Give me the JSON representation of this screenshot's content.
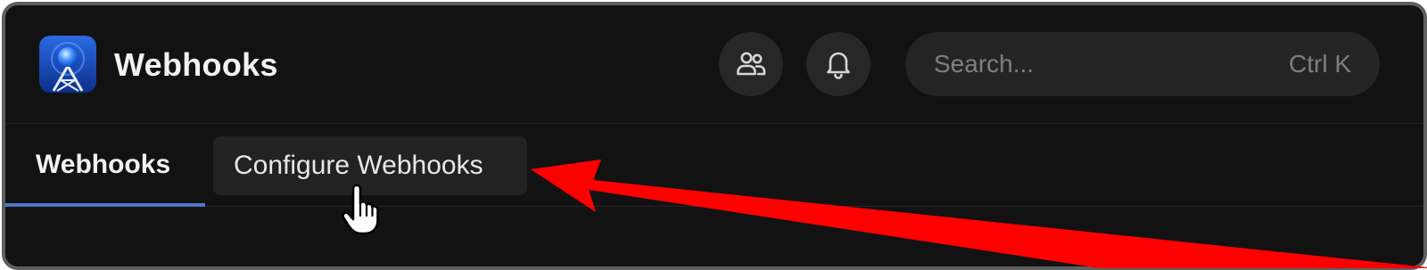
{
  "app": {
    "title": "Webhooks",
    "logo_icon": "radio-tower-icon"
  },
  "header": {
    "actions": [
      {
        "name": "people-button",
        "icon": "people-icon"
      },
      {
        "name": "notifications-button",
        "icon": "bell-icon"
      }
    ]
  },
  "search": {
    "placeholder": "Search...",
    "value": "",
    "shortcut": "Ctrl K"
  },
  "tabs": [
    {
      "label": "Webhooks",
      "active": true
    },
    {
      "label": "Configure Webhooks",
      "active": false,
      "hovered": true
    }
  ],
  "annotation": {
    "arrow_color": "#ff0000",
    "cursor": "hand-pointer-icon"
  },
  "colors": {
    "background": "#121212",
    "active_tab_indicator": "#4a78c8",
    "button_background": "#272727"
  }
}
